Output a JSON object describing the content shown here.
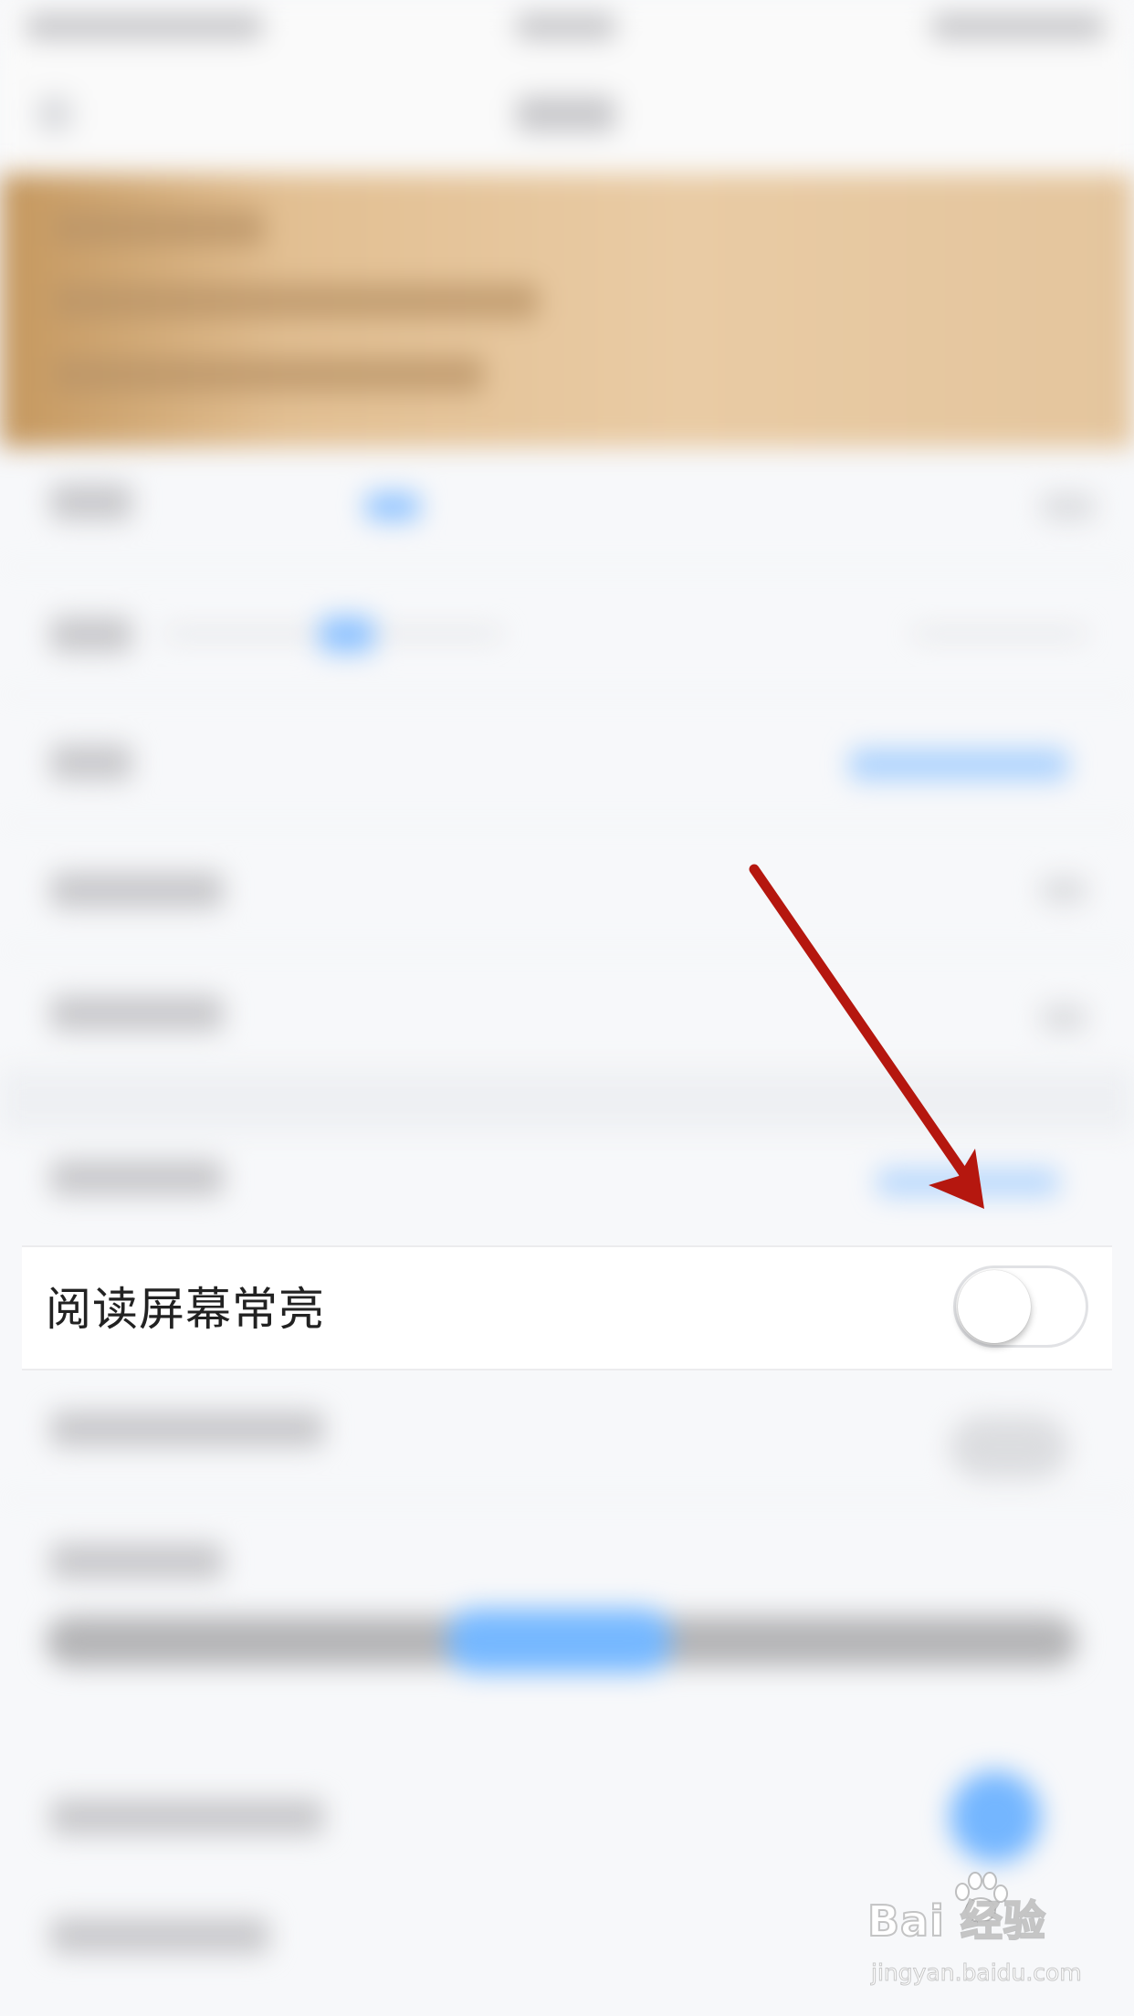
{
  "settings_row": {
    "label": "阅读屏幕常亮",
    "toggle_on": false
  },
  "watermark": {
    "logo": "Bai  经验",
    "url": "jingyan.baidu.com"
  },
  "colors": {
    "banner": "#e2bf92",
    "accent_blue": "#76b8ff",
    "arrow": "#b5170f",
    "row_text": "#222222"
  }
}
